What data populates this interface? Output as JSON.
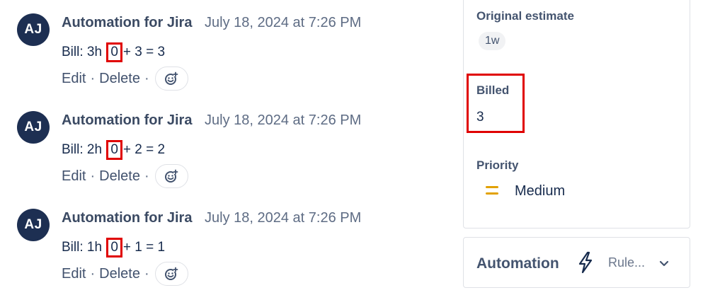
{
  "comments": [
    {
      "avatar": "AJ",
      "author": "Automation for Jira",
      "timestamp": "July 18, 2024 at 7:26 PM",
      "body_prefix": "Bill: 3h",
      "body_highlight": "0",
      "body_suffix": "+ 3 = 3"
    },
    {
      "avatar": "AJ",
      "author": "Automation for Jira",
      "timestamp": "July 18, 2024 at 7:26 PM",
      "body_prefix": "Bill: 2h",
      "body_highlight": "0",
      "body_suffix": "+ 2 = 2"
    },
    {
      "avatar": "AJ",
      "author": "Automation for Jira",
      "timestamp": "July 18, 2024 at 7:26 PM",
      "body_prefix": "Bill: 1h",
      "body_highlight": "0",
      "body_suffix": "+ 1 = 1"
    }
  ],
  "actions": {
    "edit": "Edit",
    "delete": "Delete",
    "separator": "·",
    "emoji_icon": "add-reaction-icon"
  },
  "details": {
    "original_estimate_label": "Original estimate",
    "original_estimate_value": "1w",
    "billed_label": "Billed",
    "billed_value": "3",
    "priority_label": "Priority",
    "priority_value": "Medium",
    "priority_icon": "priority-medium-icon",
    "priority_color": "#e2a100"
  },
  "automation": {
    "title": "Automation",
    "icon": "lightning-bolt-icon",
    "rules_label": "Rule...",
    "chevron_icon": "chevron-down-icon"
  },
  "colors": {
    "avatar_bg": "#1d2f52",
    "highlight_border": "#e00000"
  }
}
